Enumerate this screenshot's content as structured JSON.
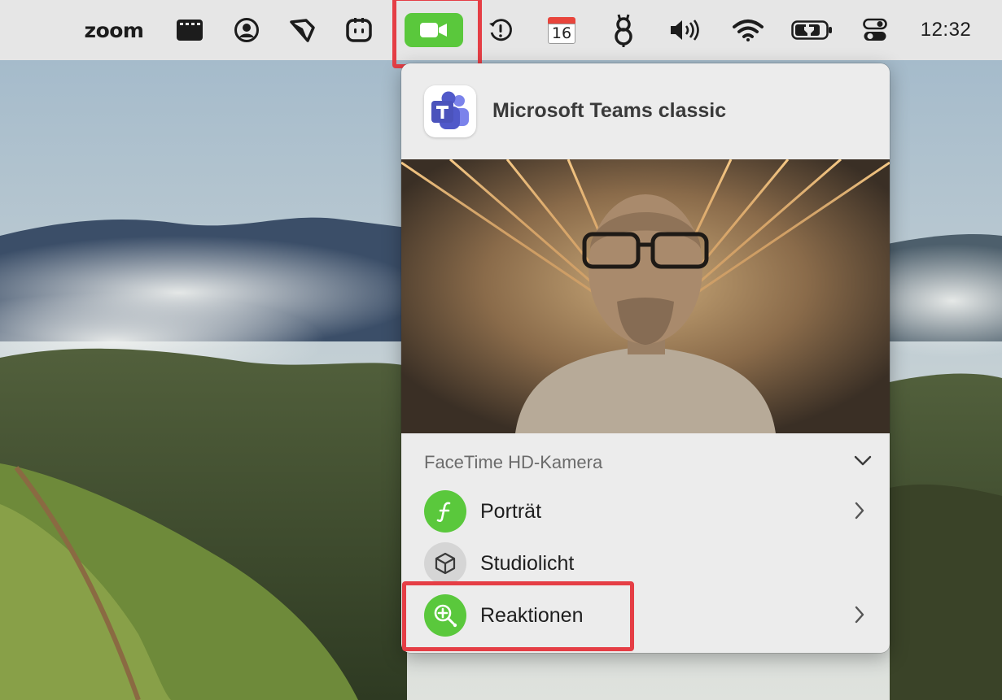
{
  "menubar": {
    "zoom_label": "zoom",
    "clock": "12:32",
    "calendar_day": "16",
    "icons": [
      "zoom-app",
      "clapperboard-icon",
      "person-circle-icon",
      "ruler-tool-icon",
      "robot-face-icon",
      "video-camera-icon",
      "time-machine-icon",
      "calendar-icon",
      "cat-tool-icon",
      "volume-icon",
      "wifi-icon",
      "battery-charging-icon",
      "control-center-icon"
    ],
    "active_color": "#5ac83c",
    "highlight_color": "#e53e45"
  },
  "popover": {
    "app_name": "Microsoft Teams classic",
    "camera_name": "FaceTime HD-Kamera",
    "options": [
      {
        "label": "Porträt",
        "icon": "portrait-f-icon",
        "color": "#5ac83c",
        "has_submenu": true
      },
      {
        "label": "Studiolicht",
        "icon": "cube-icon",
        "color": "#d5d5d5",
        "has_submenu": false
      },
      {
        "label": "Reaktionen",
        "icon": "reactions-magnifier-icon",
        "color": "#5ac83c",
        "has_submenu": true
      }
    ]
  }
}
